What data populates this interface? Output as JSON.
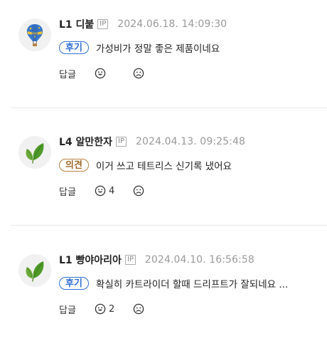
{
  "comments": [
    {
      "nickname": "L1 디붙",
      "ip_badge": "IP",
      "timestamp": "2024.06.18. 14:09:30",
      "tag": "후기",
      "text": "가성비가 정말 좋은 제품이네요",
      "reply_label": "답글",
      "like_count": "",
      "avatar_icon": "hot-air-balloon-icon"
    },
    {
      "nickname": "L4 알만한자",
      "ip_badge": "IP",
      "timestamp": "2024.04.13. 09:25:48",
      "tag": "의견",
      "text": "이거 쓰고 테트리스 신기록 냈어요",
      "reply_label": "답글",
      "like_count": "4",
      "avatar_icon": "leaf-icon"
    },
    {
      "nickname": "L1 빵야아리아",
      "ip_badge": "IP",
      "timestamp": "2024.04.10. 16:56:58",
      "tag": "후기",
      "text": "확실히 카트라이더 할때 드리프트가 잘되네요 ...",
      "reply_label": "답글",
      "like_count": "2",
      "avatar_icon": "leaf-icon"
    }
  ],
  "colors": {
    "tag_review": "#2f6fd2",
    "tag_opinion": "#a06b2a",
    "leaf": "#5a9e2f"
  }
}
